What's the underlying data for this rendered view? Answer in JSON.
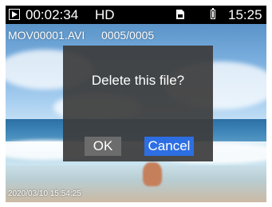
{
  "status_bar": {
    "recording_time": "00:02:34",
    "quality": "HD",
    "clock": "15:25",
    "icons": [
      "play-icon",
      "sd-card-icon",
      "battery-icon"
    ]
  },
  "file": {
    "name": "MOV00001.AVI",
    "index": "0005/0005"
  },
  "dialog": {
    "message": "Delete this file?",
    "ok_label": "OK",
    "cancel_label": "Cancel"
  },
  "overlay": {
    "timestamp": "2020/03/10 15:54:25"
  },
  "colors": {
    "status_bar_bg": "#000000",
    "dialog_bg": "#3c3c3c",
    "ok_button": "#6c6c6c",
    "cancel_button_selected": "#2d6fe3",
    "text": "#ffffff"
  }
}
